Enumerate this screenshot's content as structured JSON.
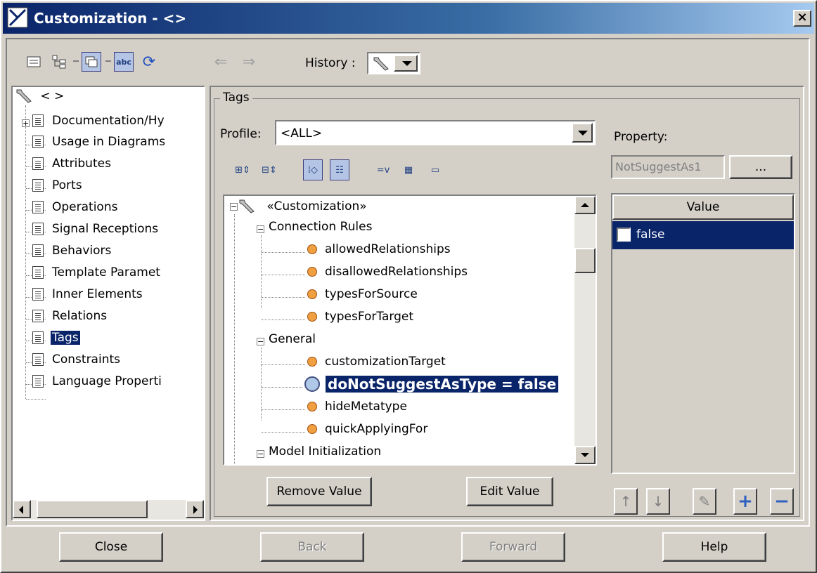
{
  "window": {
    "title": "Customization - <>",
    "close_glyph": "×"
  },
  "toolbar": {
    "history_label": "History :"
  },
  "left_tree": {
    "root_label": "< >",
    "items": [
      {
        "label": "Documentation/Hy",
        "expandable": true
      },
      {
        "label": "Usage in Diagrams"
      },
      {
        "label": "Attributes"
      },
      {
        "label": "Ports"
      },
      {
        "label": "Operations"
      },
      {
        "label": "Signal Receptions"
      },
      {
        "label": "Behaviors"
      },
      {
        "label": "Template Paramet"
      },
      {
        "label": "Inner Elements"
      },
      {
        "label": "Relations"
      },
      {
        "label": "Tags",
        "selected": true
      },
      {
        "label": "Constraints"
      },
      {
        "label": "Language Properti"
      }
    ]
  },
  "tags": {
    "group_title": "Tags",
    "profile_label": "Profile:",
    "profile_value": "<ALL>",
    "tree": {
      "root": "«Customization»",
      "groups": [
        {
          "label": "Connection Rules",
          "items": [
            "allowedRelationships",
            "disallowedRelationships",
            "typesForSource",
            "typesForTarget"
          ]
        },
        {
          "label": "General",
          "items": [
            "customizationTarget",
            "doNotSuggestAsType = false",
            "hideMetatype",
            "quickApplyingFor"
          ]
        },
        {
          "label": "Model Initialization",
          "items": []
        }
      ],
      "selected_item": "doNotSuggestAsType = false"
    },
    "remove_button": "Remove Value",
    "edit_button": "Edit Value"
  },
  "property": {
    "label": "Property:",
    "field_value": "NotSuggestAs1",
    "dots_button": "...",
    "value_header": "Value",
    "value_row": "false"
  },
  "bottom": {
    "close": "Close",
    "back": "Back",
    "forward": "Forward",
    "help": "Help"
  },
  "colors": {
    "selection": "#0a246a",
    "face": "#d4d0c8",
    "title_gradient_start": "#0a246a"
  }
}
